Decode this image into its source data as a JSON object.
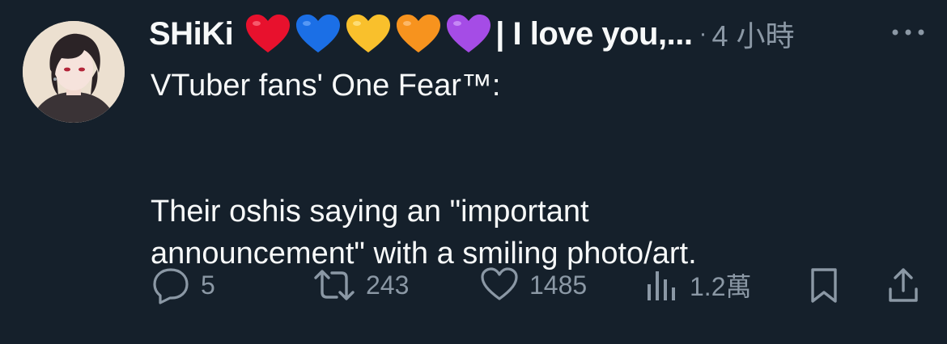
{
  "tweet": {
    "display_name": "SHiKi",
    "hearts": [
      {
        "name": "red-heart-icon",
        "color": "#e8112d"
      },
      {
        "name": "blue-heart-icon",
        "color": "#1b6fe6"
      },
      {
        "name": "yellow-heart-icon",
        "color": "#f9c02c"
      },
      {
        "name": "orange-heart-icon",
        "color": "#f7931e"
      },
      {
        "name": "purple-heart-icon",
        "color": "#a54ce6"
      }
    ],
    "name_suffix": "| I love you,...",
    "separator": "·",
    "timestamp": "4 小時",
    "body": {
      "line1": "VTuber fans' One Fear™:",
      "line2": "Their oshis saying an \"important",
      "line3": "announcement\" with a smiling photo/art."
    }
  },
  "actions": {
    "replies": "5",
    "retweets": "243",
    "likes": "1485",
    "views": "1.2萬"
  },
  "colors": {
    "background": "#15202b",
    "text": "#f7f9f9",
    "muted": "#8b98a5"
  }
}
